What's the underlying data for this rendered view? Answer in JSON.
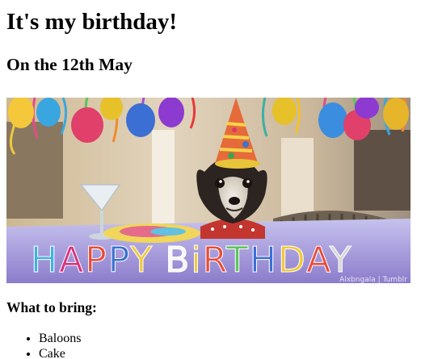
{
  "page": {
    "title": "It's my birthday!",
    "subtitle": "On the 12th May",
    "image": {
      "banner_text": "HAPPY BIRTHDAY",
      "watermark": "Alxbngala | Tumblr"
    },
    "bring_heading": "What to bring:",
    "bring_items": [
      "Baloons",
      "Cake"
    ]
  },
  "colors": {
    "table_purple": "#8f7fd0",
    "background_wall": "#d8c8ae"
  }
}
